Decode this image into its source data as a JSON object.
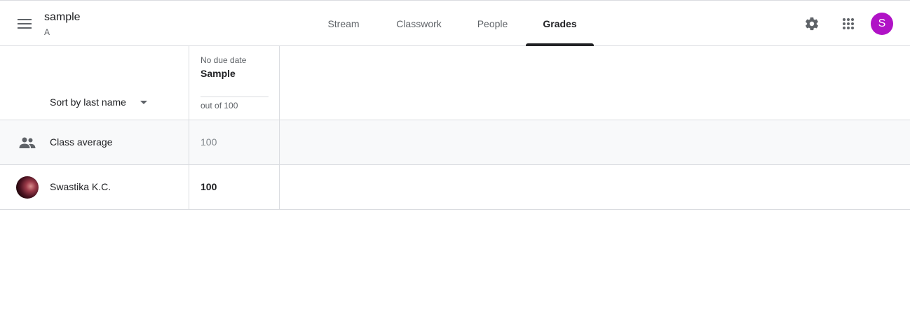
{
  "header": {
    "class_name": "sample",
    "section": "A",
    "icons": {
      "menu": "menu-icon",
      "settings": "gear-icon",
      "apps": "apps-grid-icon"
    },
    "avatar_initial": "S",
    "avatar_color": "#b012c6"
  },
  "tabs": [
    {
      "label": "Stream",
      "active": false
    },
    {
      "label": "Classwork",
      "active": false
    },
    {
      "label": "People",
      "active": false
    },
    {
      "label": "Grades",
      "active": true
    }
  ],
  "grades": {
    "sort_label": "Sort by last name",
    "assignment": {
      "due": "No due date",
      "title": "Sample",
      "points": "out of 100"
    },
    "class_average": {
      "label": "Class average",
      "grade": "100",
      "icon": "people-icon"
    },
    "students": [
      {
        "name": "Swastika K.C.",
        "grade": "100"
      }
    ]
  },
  "colors": {
    "accent": "#202124",
    "average_row_bg": "#f8f9fa",
    "divider": "#dadce0"
  }
}
